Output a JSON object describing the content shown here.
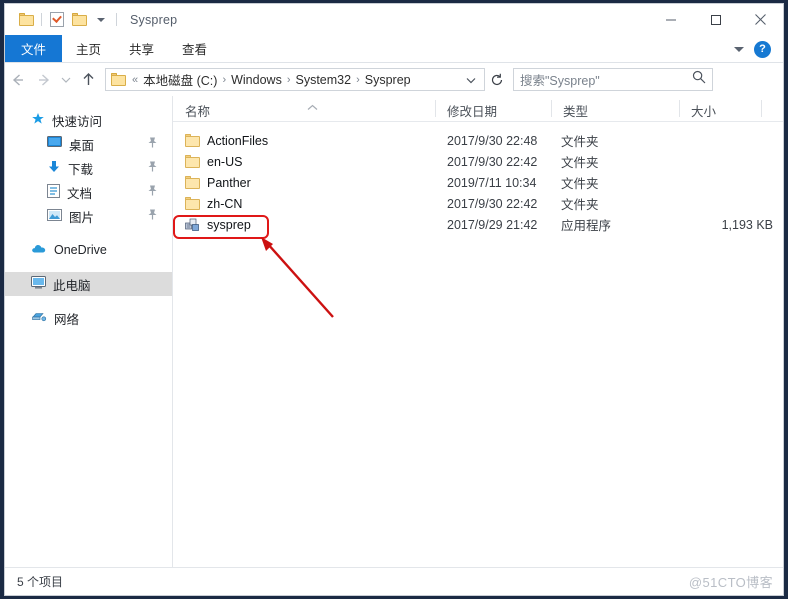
{
  "window": {
    "title": "Sysprep",
    "quick_access": [
      "folder-icon",
      "properties-icon",
      "new-folder-icon",
      "customize-caret-icon"
    ],
    "controls": {
      "minimize": "minimize-icon",
      "maximize": "maximize-icon",
      "close": "close-icon"
    }
  },
  "ribbon": {
    "tabs": [
      {
        "label": "文件",
        "active": true
      },
      {
        "label": "主页",
        "active": false
      },
      {
        "label": "共享",
        "active": false
      },
      {
        "label": "查看",
        "active": false
      }
    ],
    "collapse_icon": "chevron-down-icon",
    "help_icon": "help-icon",
    "help_glyph": "?"
  },
  "address": {
    "back_icon": "back-arrow-icon",
    "forward_icon": "forward-arrow-icon",
    "recent_icon": "recent-locations-icon",
    "up_icon": "up-arrow-icon",
    "root_icon": "folder-icon",
    "overflow": "«",
    "crumbs": [
      "本地磁盘 (C:)",
      "Windows",
      "System32",
      "Sysprep"
    ],
    "separator": "›",
    "dropdown_icon": "chevron-down-icon",
    "refresh_icon": "refresh-icon"
  },
  "search": {
    "placeholder": "搜索\"Sysprep\"",
    "icon": "search-icon"
  },
  "nav": {
    "items": [
      {
        "label": "快速访问",
        "icon": "pin-star-icon",
        "level": 1,
        "pinned": false,
        "selected": false
      },
      {
        "label": "桌面",
        "icon": "desktop-icon",
        "level": 2,
        "pinned": true,
        "selected": false
      },
      {
        "label": "下载",
        "icon": "download-icon",
        "level": 2,
        "pinned": true,
        "selected": false
      },
      {
        "label": "文档",
        "icon": "documents-icon",
        "level": 2,
        "pinned": true,
        "selected": false
      },
      {
        "label": "图片",
        "icon": "pictures-icon",
        "level": 2,
        "pinned": true,
        "selected": false
      },
      {
        "label": "OneDrive",
        "icon": "onedrive-cloud-icon",
        "level": 1,
        "pinned": false,
        "selected": false
      },
      {
        "label": "此电脑",
        "icon": "this-pc-icon",
        "level": 1,
        "pinned": false,
        "selected": true
      },
      {
        "label": "网络",
        "icon": "network-icon",
        "level": 1,
        "pinned": false,
        "selected": false
      }
    ]
  },
  "filelist": {
    "columns": [
      {
        "label": "名称"
      },
      {
        "label": "修改日期"
      },
      {
        "label": "类型"
      },
      {
        "label": "大小"
      }
    ],
    "sort_indicator": "chevron-up-icon",
    "rows": [
      {
        "name": "ActionFiles",
        "date": "2017/9/30 22:48",
        "type": "文件夹",
        "size": "",
        "icon": "folder-icon"
      },
      {
        "name": "en-US",
        "date": "2017/9/30 22:42",
        "type": "文件夹",
        "size": "",
        "icon": "folder-icon"
      },
      {
        "name": "Panther",
        "date": "2019/7/11 10:34",
        "type": "文件夹",
        "size": "",
        "icon": "folder-icon"
      },
      {
        "name": "zh-CN",
        "date": "2017/9/30 22:42",
        "type": "文件夹",
        "size": "",
        "icon": "folder-icon"
      },
      {
        "name": "sysprep",
        "date": "2017/9/29 21:42",
        "type": "应用程序",
        "size": "1,193 KB",
        "icon": "sysprep-app-icon"
      }
    ]
  },
  "annotation": {
    "highlight_color": "#e01818",
    "highlight_target": "sysprep",
    "arrow": "pointer-arrow"
  },
  "status": {
    "text": "5 个项目"
  },
  "watermark": {
    "text": "@51CTO博客"
  },
  "colors": {
    "accent": "#1577d4",
    "titlebar": "#ffffff",
    "selection": "#dcdcdc",
    "annotation": "#e01818"
  }
}
